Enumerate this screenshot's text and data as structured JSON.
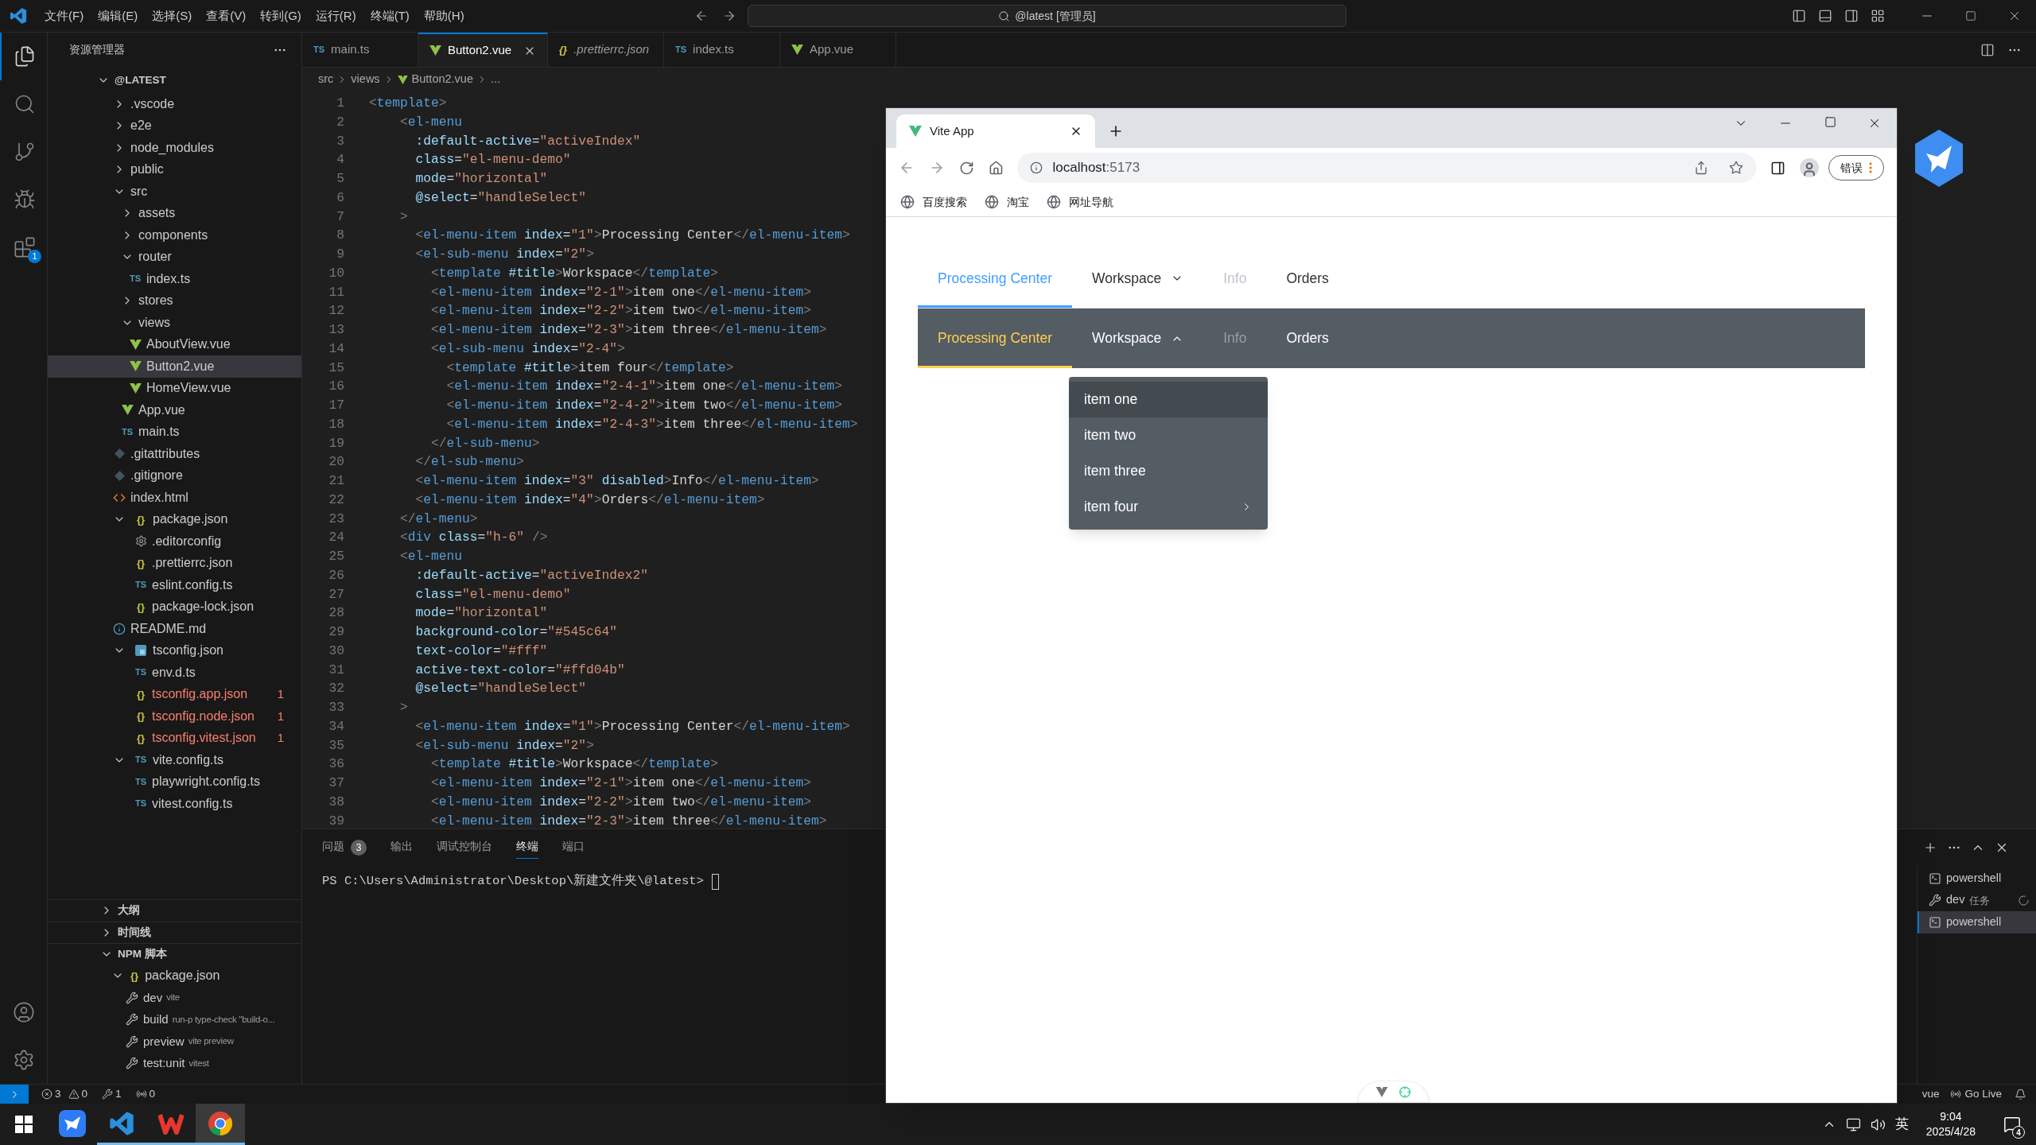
{
  "title_bar": {
    "menus": [
      "文件(F)",
      "编辑(E)",
      "选择(S)",
      "查看(V)",
      "转到(G)",
      "运行(R)",
      "终端(T)",
      "帮助(H)"
    ],
    "search": "@latest [管理员]"
  },
  "activity_bar": {
    "items": [
      {
        "selected": true
      },
      {
        "selected": false
      },
      {
        "selected": false
      },
      {
        "selected": false
      },
      {
        "selected": false,
        "badge": "1"
      }
    ]
  },
  "explorer": {
    "title": "资源管理器",
    "root": {
      "label": "@LATEST",
      "expanded": true
    },
    "tree": [
      {
        "name": ".vscode",
        "kind": "folder",
        "expanded": false,
        "selected": false,
        "error": false
      },
      {
        "name": "e2e",
        "kind": "folder",
        "expanded": false,
        "selected": false,
        "error": false
      },
      {
        "name": "node_modules",
        "kind": "folder",
        "expanded": false,
        "selected": false,
        "error": false
      },
      {
        "name": "public",
        "kind": "folder",
        "expanded": false,
        "selected": false,
        "error": false
      },
      {
        "name": "src",
        "kind": "folder",
        "expanded": true,
        "selected": false,
        "error": false,
        "children": [
          {
            "name": "assets",
            "kind": "folder",
            "expanded": false,
            "selected": false,
            "error": false
          },
          {
            "name": "components",
            "kind": "folder",
            "expanded": false,
            "selected": false,
            "error": false
          },
          {
            "name": "router",
            "kind": "folder",
            "expanded": true,
            "selected": false,
            "error": false,
            "children": [
              {
                "name": "index.ts",
                "kind": "ts",
                "glyph": "TS",
                "selected": false,
                "error": false
              }
            ]
          },
          {
            "name": "stores",
            "kind": "folder",
            "expanded": false,
            "selected": false,
            "error": false
          },
          {
            "name": "views",
            "kind": "folder",
            "expanded": true,
            "selected": false,
            "error": false,
            "children": [
              {
                "name": "AboutView.vue",
                "kind": "vue",
                "selected": false,
                "error": false
              },
              {
                "name": "Button2.vue",
                "kind": "vue",
                "selected": true,
                "error": false
              },
              {
                "name": "HomeView.vue",
                "kind": "vue",
                "selected": false,
                "error": false
              }
            ]
          },
          {
            "name": "App.vue",
            "kind": "vue",
            "selected": false,
            "error": false
          },
          {
            "name": "main.ts",
            "kind": "ts",
            "glyph": "TS",
            "selected": false,
            "error": false
          }
        ]
      },
      {
        "name": ".gitattributes",
        "kind": "git",
        "selected": false,
        "error": false
      },
      {
        "name": ".gitignore",
        "kind": "git",
        "selected": false,
        "error": false
      },
      {
        "name": "index.html",
        "kind": "html",
        "selected": false,
        "error": false
      },
      {
        "name": "package.json",
        "kind": "json",
        "glyph": "{}",
        "expanded": true,
        "selected": false,
        "error": false,
        "children": [
          {
            "name": ".editorconfig",
            "kind": "gear",
            "selected": false,
            "error": false
          },
          {
            "name": ".prettierrc.json",
            "kind": "json",
            "glyph": "{}",
            "selected": false,
            "error": false
          },
          {
            "name": "eslint.config.ts",
            "kind": "ts",
            "glyph": "TS",
            "selected": false,
            "error": false
          },
          {
            "name": "package-lock.json",
            "kind": "json",
            "glyph": "{}",
            "selected": false,
            "error": false
          }
        ]
      },
      {
        "name": "README.md",
        "kind": "info",
        "selected": false,
        "error": false
      },
      {
        "name": "tsconfig.json",
        "kind": "tsconfig",
        "expanded": true,
        "selected": false,
        "error": false,
        "children": [
          {
            "name": "env.d.ts",
            "kind": "ts",
            "glyph": "TS",
            "selected": false,
            "error": false
          },
          {
            "name": "tsconfig.app.json",
            "kind": "json",
            "glyph": "{}",
            "selected": false,
            "error": true,
            "badge": "1"
          },
          {
            "name": "tsconfig.node.json",
            "kind": "json",
            "glyph": "{}",
            "selected": false,
            "error": true,
            "badge": "1"
          },
          {
            "name": "tsconfig.vitest.json",
            "kind": "json",
            "glyph": "{}",
            "selected": false,
            "error": true,
            "badge": "1"
          }
        ]
      },
      {
        "name": "vite.config.ts",
        "kind": "ts",
        "glyph": "TS",
        "expanded": true,
        "selected": false,
        "error": false,
        "children": [
          {
            "name": "playwright.config.ts",
            "kind": "ts",
            "glyph": "TS",
            "selected": false,
            "error": false
          },
          {
            "name": "vitest.config.ts",
            "kind": "ts",
            "glyph": "TS",
            "selected": false,
            "error": false
          }
        ]
      }
    ],
    "sections": [
      {
        "label": "大纲",
        "expanded": false
      },
      {
        "label": "时间线",
        "expanded": false
      },
      {
        "label": "NPM 脚本",
        "expanded": true
      }
    ],
    "npm": {
      "package": {
        "name": "package.json",
        "glyph": "{}",
        "expanded": true
      },
      "scripts": [
        {
          "name": "dev",
          "command": "vite"
        },
        {
          "name": "build",
          "command": "run-p type-check \"build-o..."
        },
        {
          "name": "preview",
          "command": "vite preview"
        },
        {
          "name": "test:unit",
          "command": "vitest"
        }
      ]
    }
  },
  "editor": {
    "tabs": [
      {
        "label": "main.ts",
        "kind": "ts",
        "glyph": "TS",
        "selected": false,
        "preview": false
      },
      {
        "label": "Button2.vue",
        "kind": "vue",
        "selected": true,
        "preview": false
      },
      {
        "label": ".prettierrc.json",
        "kind": "json",
        "glyph": "{}",
        "selected": false,
        "preview": true
      },
      {
        "label": "index.ts",
        "kind": "ts",
        "glyph": "TS",
        "selected": false,
        "preview": false
      },
      {
        "label": "App.vue",
        "kind": "vue",
        "selected": false,
        "preview": false
      }
    ],
    "breadcrumb": [
      {
        "label": "src",
        "kind": "folder"
      },
      {
        "label": "views",
        "kind": "folder"
      },
      {
        "label": "Button2.vue",
        "kind": "vue"
      },
      {
        "label": "...",
        "kind": "symbol"
      }
    ],
    "lines": [
      {
        "number": "1",
        "text": "<template>"
      },
      {
        "number": "2",
        "text": "    <el-menu"
      },
      {
        "number": "3",
        "text": "      :default-active=\"activeIndex\""
      },
      {
        "number": "4",
        "text": "      class=\"el-menu-demo\""
      },
      {
        "number": "5",
        "text": "      mode=\"horizontal\""
      },
      {
        "number": "6",
        "text": "      @select=\"handleSelect\""
      },
      {
        "number": "7",
        "text": "    >"
      },
      {
        "number": "8",
        "text": "      <el-menu-item index=\"1\">Processing Center</el-menu-item>"
      },
      {
        "number": "9",
        "text": "      <el-sub-menu index=\"2\">"
      },
      {
        "number": "10",
        "text": "        <template #title>Workspace</template>"
      },
      {
        "number": "11",
        "text": "        <el-menu-item index=\"2-1\">item one</el-menu-item>"
      },
      {
        "number": "12",
        "text": "        <el-menu-item index=\"2-2\">item two</el-menu-item>"
      },
      {
        "number": "13",
        "text": "        <el-menu-item index=\"2-3\">item three</el-menu-item>"
      },
      {
        "number": "14",
        "text": "        <el-sub-menu index=\"2-4\">"
      },
      {
        "number": "15",
        "text": "          <template #title>item four</template>"
      },
      {
        "number": "16",
        "text": "          <el-menu-item index=\"2-4-1\">item one</el-menu-item>"
      },
      {
        "number": "17",
        "text": "          <el-menu-item index=\"2-4-2\">item two</el-menu-item>"
      },
      {
        "number": "18",
        "text": "          <el-menu-item index=\"2-4-3\">item three</el-menu-item>"
      },
      {
        "number": "19",
        "text": "        </el-sub-menu>"
      },
      {
        "number": "20",
        "text": "      </el-sub-menu>"
      },
      {
        "number": "21",
        "text": "      <el-menu-item index=\"3\" disabled>Info</el-menu-item>"
      },
      {
        "number": "22",
        "text": "      <el-menu-item index=\"4\">Orders</el-menu-item>"
      },
      {
        "number": "23",
        "text": "    </el-menu>"
      },
      {
        "number": "24",
        "text": "    <div class=\"h-6\" />"
      },
      {
        "number": "25",
        "text": "    <el-menu"
      },
      {
        "number": "26",
        "text": "      :default-active=\"activeIndex2\""
      },
      {
        "number": "27",
        "text": "      class=\"el-menu-demo\""
      },
      {
        "number": "28",
        "text": "      mode=\"horizontal\""
      },
      {
        "number": "29",
        "text": "      background-color=\"#545c64\""
      },
      {
        "number": "30",
        "text": "      text-color=\"#fff\""
      },
      {
        "number": "31",
        "text": "      active-text-color=\"#ffd04b\""
      },
      {
        "number": "32",
        "text": "      @select=\"handleSelect\""
      },
      {
        "number": "33",
        "text": "    >"
      },
      {
        "number": "34",
        "text": "      <el-menu-item index=\"1\">Processing Center</el-menu-item>"
      },
      {
        "number": "35",
        "text": "      <el-sub-menu index=\"2\">"
      },
      {
        "number": "36",
        "text": "        <template #title>Workspace</template>"
      },
      {
        "number": "37",
        "text": "        <el-menu-item index=\"2-1\">item one</el-menu-item>"
      },
      {
        "number": "38",
        "text": "        <el-menu-item index=\"2-2\">item two</el-menu-item>"
      },
      {
        "number": "39",
        "text": "        <el-menu-item index=\"2-3\">item three</el-menu-item>"
      }
    ]
  },
  "panel": {
    "tabs": [
      {
        "label": "问题",
        "badge": "3",
        "selected": false
      },
      {
        "label": "输出",
        "selected": false
      },
      {
        "label": "调试控制台",
        "selected": false
      },
      {
        "label": "终端",
        "selected": true
      },
      {
        "label": "端口",
        "selected": false
      }
    ],
    "prompt": "PS C:\\Users\\Administrator\\Desktop\\新建文件夹\\@latest>",
    "terminals": [
      {
        "label": "powershell",
        "kind": "shell",
        "selected": false,
        "running": false
      },
      {
        "label": "dev",
        "note": "任务",
        "kind": "task",
        "selected": false,
        "running": true
      },
      {
        "label": "powershell",
        "kind": "shell",
        "selected": true,
        "running": false
      }
    ]
  },
  "status_bar": {
    "errors": "3",
    "warnings": "0",
    "tasks": "1",
    "ports": "0",
    "language": "vue",
    "go_live": "Go Live"
  },
  "browser": {
    "tab": {
      "title": "Vite App"
    },
    "address": {
      "host": "localhost",
      "port": ":5173"
    },
    "profile_button": "错误",
    "bookmarks": [
      "百度搜索",
      "淘宝",
      "网址导航"
    ],
    "menus": [
      {
        "kind": "light",
        "items": [
          {
            "label": "Processing Center",
            "kind": "item",
            "selected": true,
            "disabled": false
          },
          {
            "label": "Workspace",
            "kind": "submenu",
            "selected": false,
            "disabled": false,
            "expanded": false
          },
          {
            "label": "Info",
            "kind": "item",
            "selected": false,
            "disabled": true
          },
          {
            "label": "Orders",
            "kind": "item",
            "selected": false,
            "disabled": false
          }
        ]
      },
      {
        "kind": "dark",
        "items": [
          {
            "label": "Processing Center",
            "kind": "item",
            "selected": true,
            "disabled": false
          },
          {
            "label": "Workspace",
            "kind": "submenu",
            "selected": false,
            "disabled": false,
            "expanded": true
          },
          {
            "label": "Info",
            "kind": "item",
            "selected": false,
            "disabled": true
          },
          {
            "label": "Orders",
            "kind": "item",
            "selected": false,
            "disabled": false
          }
        ]
      }
    ],
    "dropdown": {
      "items": [
        {
          "label": "item one",
          "kind": "item",
          "hovered": true
        },
        {
          "label": "item two",
          "kind": "item",
          "hovered": false
        },
        {
          "label": "item three",
          "kind": "item",
          "hovered": false
        },
        {
          "label": "item four",
          "kind": "submenu",
          "hovered": false
        }
      ]
    }
  },
  "taskbar": {
    "apps": [
      {
        "kind": "bird",
        "selected": false,
        "running": false
      },
      {
        "kind": "editor",
        "selected": false,
        "running": true
      },
      {
        "kind": "office",
        "selected": false,
        "running": true
      },
      {
        "kind": "browser",
        "selected": true,
        "running": true
      }
    ],
    "ime": "英",
    "time": "9:04",
    "date": "2025/4/28",
    "notifications": "4"
  }
}
